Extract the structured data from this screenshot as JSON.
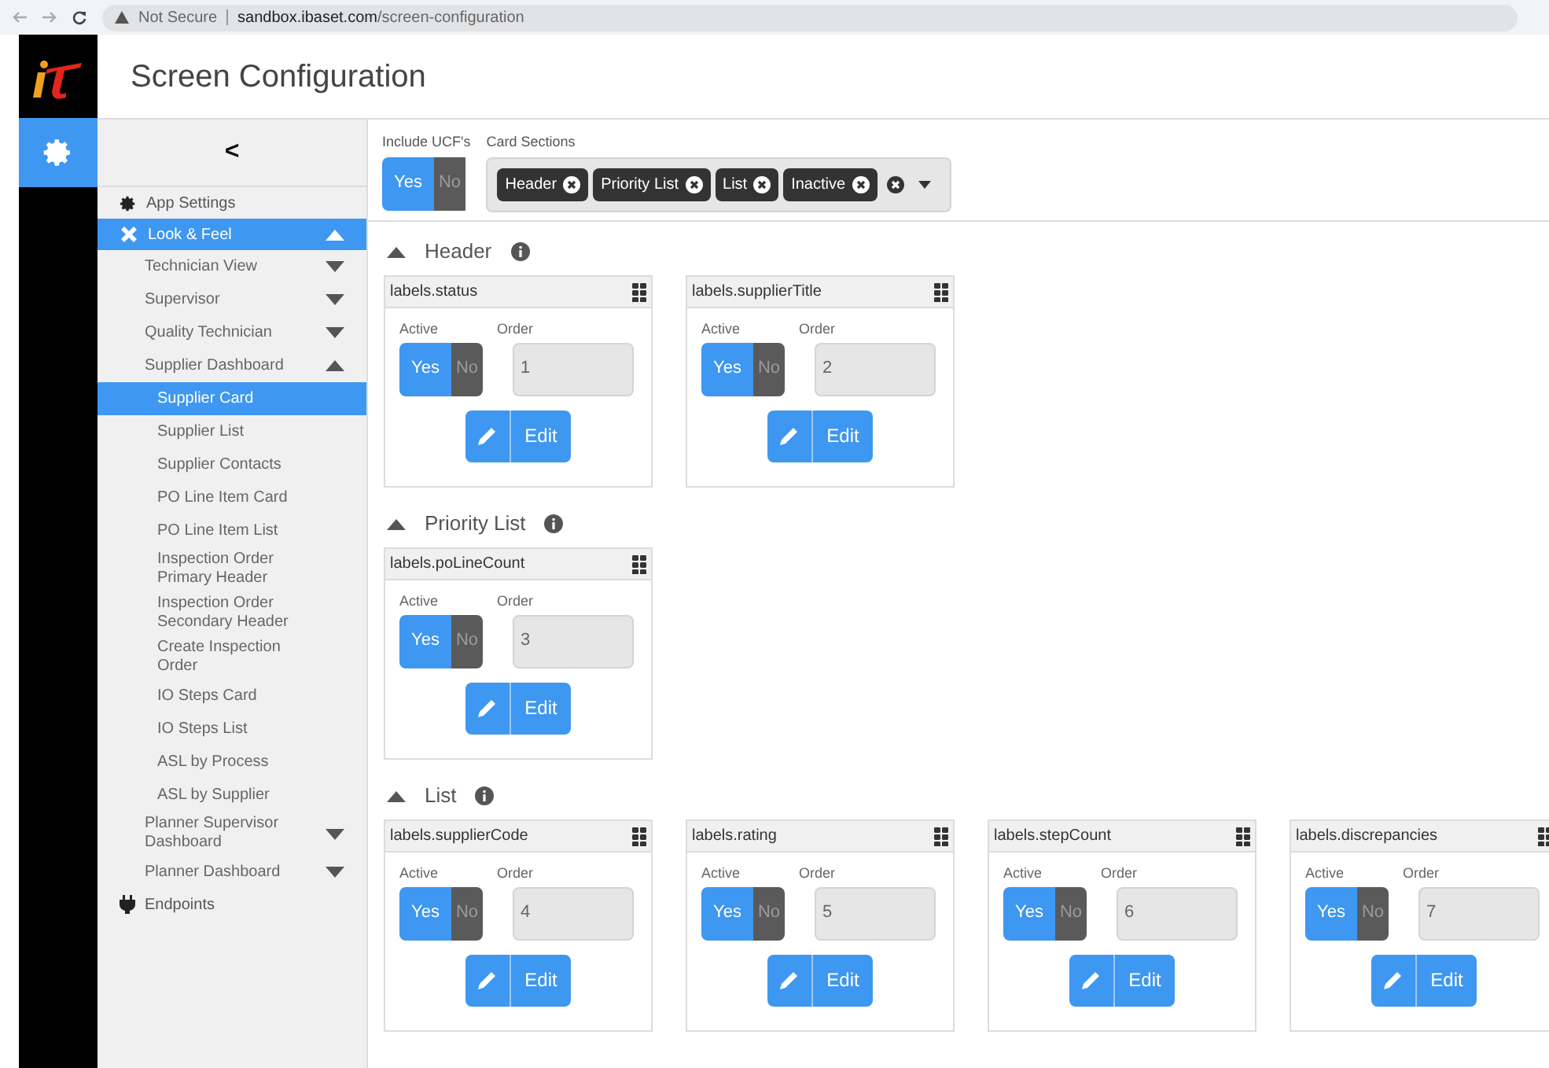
{
  "browser": {
    "security": "Not Secure",
    "url_host": "sandbox.ibaset.com",
    "url_path": "/screen-configuration"
  },
  "page_title": "Screen Configuration",
  "sidebar": {
    "collapse": "<",
    "items": [
      {
        "label": "App Settings",
        "selected": false
      },
      {
        "label": "Look & Feel",
        "selected": true,
        "expanded": true,
        "children": [
          {
            "label": "Technician View",
            "expanded": false,
            "selected": false
          },
          {
            "label": "Supervisor",
            "expanded": false,
            "selected": false
          },
          {
            "label": "Quality Technician",
            "expanded": false,
            "selected": false
          },
          {
            "label": "Supplier Dashboard",
            "expanded": true,
            "selected": false,
            "children": [
              {
                "label": "Supplier Card",
                "selected": true
              },
              {
                "label": "Supplier List",
                "selected": false
              },
              {
                "label": "Supplier Contacts",
                "selected": false
              },
              {
                "label": "PO Line Item Card",
                "selected": false
              },
              {
                "label": "PO Line Item List",
                "selected": false
              },
              {
                "label": "Inspection Order Primary Header",
                "selected": false
              },
              {
                "label": "Inspection Order Secondary Header",
                "selected": false
              },
              {
                "label": "Create Inspection Order",
                "selected": false
              },
              {
                "label": "IO Steps Card",
                "selected": false
              },
              {
                "label": "IO Steps List",
                "selected": false
              },
              {
                "label": "ASL by Process",
                "selected": false
              },
              {
                "label": "ASL by Supplier",
                "selected": false
              }
            ]
          },
          {
            "label": "Planner Supervisor Dashboard",
            "expanded": false,
            "selected": false
          },
          {
            "label": "Planner Dashboard",
            "expanded": false,
            "selected": false
          }
        ]
      },
      {
        "label": "Endpoints",
        "selected": false
      }
    ]
  },
  "filters": {
    "include_ucf": {
      "label": "Include UCF's",
      "yes": "Yes",
      "no": "No",
      "on": true
    },
    "card_sections": {
      "label": "Card Sections",
      "chips": [
        "Header",
        "Priority List",
        "List",
        "Inactive"
      ]
    }
  },
  "sections": [
    {
      "title": "Header",
      "expanded": true,
      "cards": [
        {
          "label": "labels.status",
          "active_label": "Active",
          "order_label": "Order",
          "yes": "Yes",
          "no": "No",
          "active": true,
          "order": "1",
          "edit": "Edit"
        },
        {
          "label": "labels.supplierTitle",
          "active_label": "Active",
          "order_label": "Order",
          "yes": "Yes",
          "no": "No",
          "active": true,
          "order": "2",
          "edit": "Edit"
        }
      ]
    },
    {
      "title": "Priority List",
      "expanded": true,
      "cards": [
        {
          "label": "labels.poLineCount",
          "active_label": "Active",
          "order_label": "Order",
          "yes": "Yes",
          "no": "No",
          "active": true,
          "order": "3",
          "edit": "Edit"
        }
      ]
    },
    {
      "title": "List",
      "expanded": true,
      "cards": [
        {
          "label": "labels.supplierCode",
          "active_label": "Active",
          "order_label": "Order",
          "yes": "Yes",
          "no": "No",
          "active": true,
          "order": "4",
          "edit": "Edit"
        },
        {
          "label": "labels.rating",
          "active_label": "Active",
          "order_label": "Order",
          "yes": "Yes",
          "no": "No",
          "active": true,
          "order": "5",
          "edit": "Edit"
        },
        {
          "label": "labels.stepCount",
          "active_label": "Active",
          "order_label": "Order",
          "yes": "Yes",
          "no": "No",
          "active": true,
          "order": "6",
          "edit": "Edit"
        },
        {
          "label": "labels.discrepancies",
          "active_label": "Active",
          "order_label": "Order",
          "yes": "Yes",
          "no": "No",
          "active": true,
          "order": "7",
          "edit": "Edit"
        }
      ]
    }
  ]
}
